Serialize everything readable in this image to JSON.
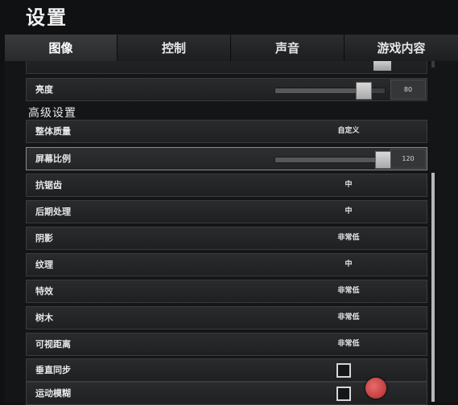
{
  "title": "设置",
  "tabs": [
    {
      "label": "图像",
      "active": true
    },
    {
      "label": "控制",
      "active": false
    },
    {
      "label": "声音",
      "active": false
    },
    {
      "label": "游戏内容",
      "active": false
    }
  ],
  "brightness": {
    "label": "亮度",
    "value": "80",
    "level": 0.8
  },
  "section_title": "高级设置",
  "overall_quality": {
    "label": "整体质量",
    "value": "自定义"
  },
  "screen_scale": {
    "label": "屏幕比例",
    "value": "120",
    "level": 0.98
  },
  "settings": [
    {
      "label": "抗锯齿",
      "value": "中"
    },
    {
      "label": "后期处理",
      "value": "中"
    },
    {
      "label": "阴影",
      "value": "非常低"
    },
    {
      "label": "纹理",
      "value": "中"
    },
    {
      "label": "特效",
      "value": "非常低"
    },
    {
      "label": "树木",
      "value": "非常低"
    },
    {
      "label": "可视距离",
      "value": "非常低"
    }
  ],
  "toggles": [
    {
      "label": "垂直同步",
      "checked": false
    },
    {
      "label": "运动模糊",
      "checked": false
    }
  ],
  "colors": {
    "background": "#101112",
    "row": "#2a2b2d",
    "highlight_border": "#8a8c8f",
    "thumb": "#cfcfcf"
  }
}
